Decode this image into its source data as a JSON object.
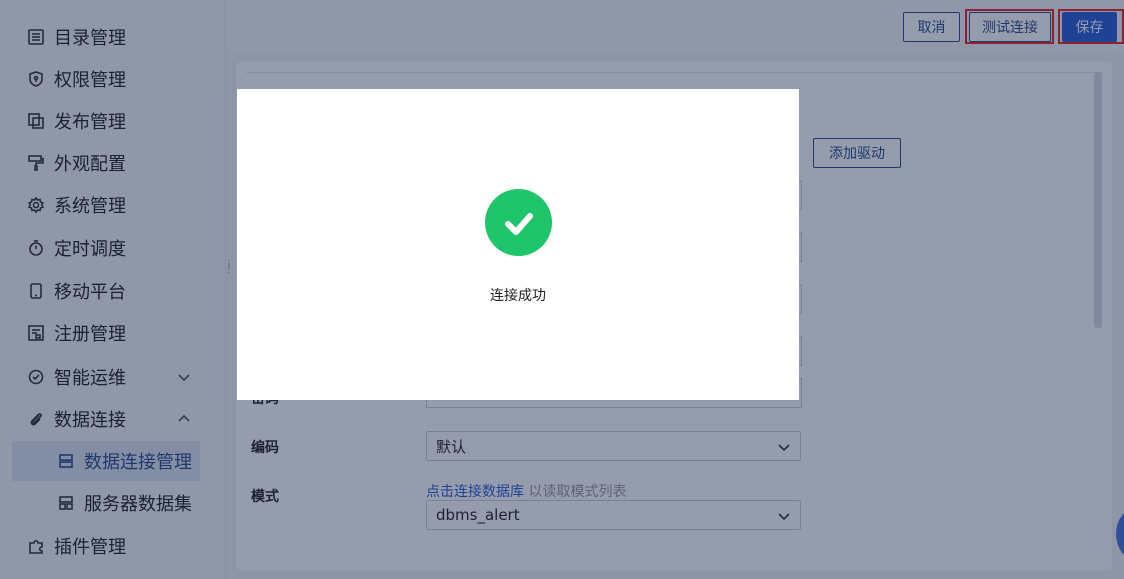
{
  "sidebar": {
    "items": [
      {
        "label": "目录管理",
        "icon": "list-icon"
      },
      {
        "label": "权限管理",
        "icon": "shield-icon"
      },
      {
        "label": "发布管理",
        "icon": "copy-icon"
      },
      {
        "label": "外观配置",
        "icon": "paint-roller-icon"
      },
      {
        "label": "系统管理",
        "icon": "gear-icon"
      },
      {
        "label": "定时调度",
        "icon": "timer-icon"
      },
      {
        "label": "移动平台",
        "icon": "mobile-icon"
      },
      {
        "label": "注册管理",
        "icon": "register-icon"
      },
      {
        "label": "智能运维",
        "icon": "ops-icon"
      },
      {
        "label": "数据连接",
        "icon": "paperclip-icon"
      },
      {
        "label": "数据连接管理",
        "icon": "data-connection-icon"
      },
      {
        "label": "服务器数据集",
        "icon": "server-dataset-icon"
      },
      {
        "label": "插件管理",
        "icon": "plugin-icon"
      }
    ]
  },
  "toolbar": {
    "cancel_label": "取消",
    "test_label": "测试连接",
    "save_label": "保存"
  },
  "form": {
    "add_driver_label": "添加驱动",
    "partial_label": "密码",
    "encoding_label": "编码",
    "encoding_value": "默认",
    "schema_label": "模式",
    "schema_hint_link": "点击连接数据库",
    "schema_hint_text": "以读取模式列表",
    "schema_value": "dbms_alert"
  },
  "modal": {
    "icon": "check-circle-icon",
    "message": "连接成功"
  },
  "colors": {
    "accent": "#2b5cd6",
    "success": "#1fc56b",
    "highlight_outline": "#e22222"
  }
}
